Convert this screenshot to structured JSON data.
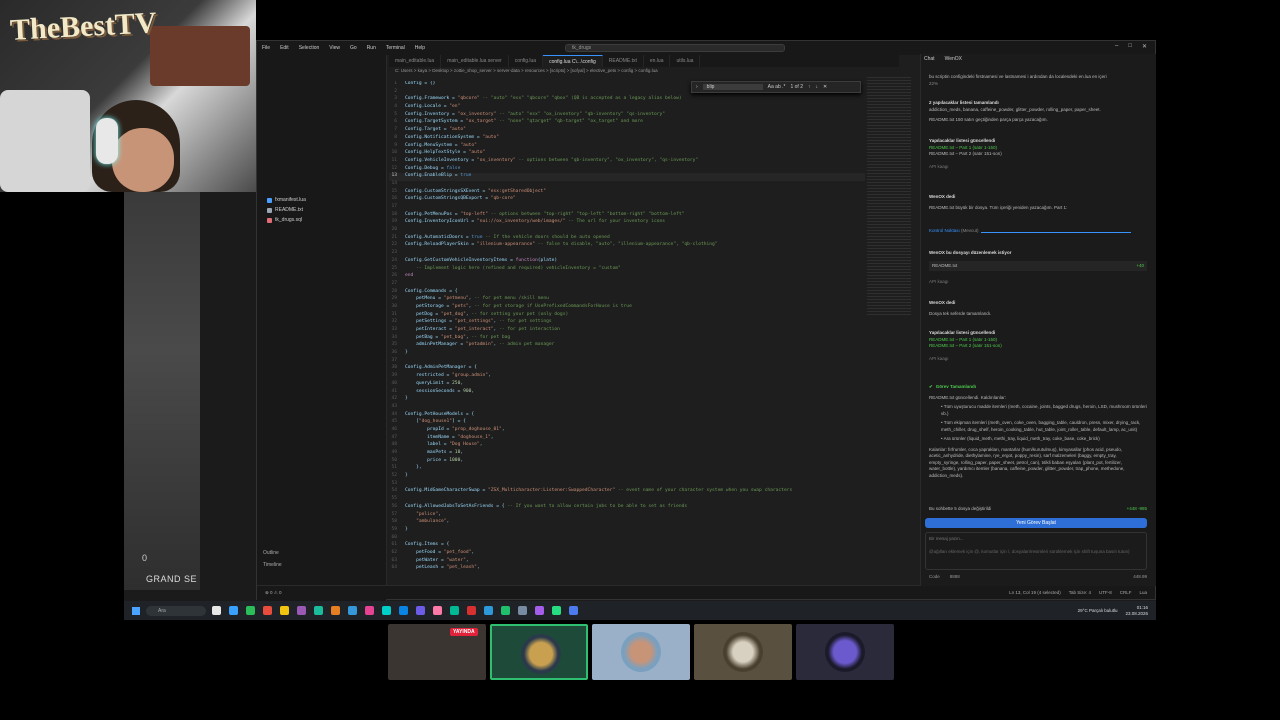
{
  "webcam": {
    "logo": "TheBestTV"
  },
  "game": {
    "text": "GRAND SE",
    "counter": "0"
  },
  "vscode": {
    "menus": [
      "File",
      "Edit",
      "Selection",
      "View",
      "Go",
      "Run",
      "Terminal",
      "Help"
    ],
    "search_placeholder": "tk_drugs",
    "tabs": [
      "main_editable.lua",
      "main_editable.lua server",
      "config.lua",
      "config.lua C\\...\\config",
      "README.txt",
      "en.lua",
      "utils.lua"
    ],
    "active_tab_index": 3,
    "breadcrumb": "C: Users > kaya > Desktop > zottie_shop_server > server-data > resources > [scripts] > [sofyal] > elective_pets > config > config.lua",
    "explorer": {
      "files": [
        {
          "name": "fxmanifest.lua",
          "color": "#4a9eff"
        },
        {
          "name": "README.txt",
          "color": "#9aa5b1"
        },
        {
          "name": "tk_drugs.sql",
          "color": "#e06c75"
        }
      ],
      "sections": [
        "Outline",
        "Timeline"
      ]
    },
    "find": {
      "query": "blip",
      "options": "Aa ab .*",
      "result": "1 of 2"
    },
    "code_lines": [
      "Config = {}",
      "",
      "Config.Framework = \"qbcore\" -- \"auto\" \"esx\" \"qbcore\" \"qbox\" (QB is accepted as a legacy alias below)",
      "Config.Locale = \"en\"",
      "Config.Inventory = \"ox_inventory\" -- \"auto\" \"esx\" \"ox_inventory\" \"qb-inventory\" \"qs-inventory\"",
      "Config.TargetSystem = \"ox_target\" -- \"none\" \"qtarget\" \"qb-target\" \"ox_target\" and more",
      "Config.Target = \"auto\"",
      "Config.NotificationSystem = \"auto\"",
      "Config.MenuSystem = \"auto\"",
      "Config.HelpTextStyle = \"auto\"",
      "Config.VehicleInventory = \"ox_inventory\" -- options between \"qb-inventory\", \"ox_inventory\", \"qs-inventory\"",
      "Config.Debug = false",
      "Config.EnableBlip = true",
      "",
      "Config.CustomStringsSXEvent = \"esx:getSharedObject\"",
      "Config.CustomStringsQBExport = \"qb-core\"",
      "",
      "Config.PetMenuPos = \"top-left\" -- options between \"top-right\" \"top-left\" \"bottom-right\" \"bottom-left\"",
      "Config.InventoryIconUrl = \"nui://ox_inventory/web/images/\" -- The url for your inventory icons",
      "",
      "Config.AutomaticDoors = true -- If the vehicle doors should be auto opened",
      "Config.ReloadPlayerSkin = \"illenium-appearance\" -- false to disable, \"auto\", \"illenium-appearance\", \"qb-clothing\"",
      "",
      "Config.GetCustomVehicleInventoryItems = function(plate)",
      "    -- Implement logic here (refined and required) vehicleInventory = \"custom\"",
      "end",
      "",
      "Config.Commands = {",
      "    petMenu = \"petmenu\", -- for pet menu /skill menu",
      "    petStorage = \"pets\", -- for pet storage if UsePrefixedCommandsForHouse is true",
      "    petDog = \"pet_dog\", -- for setting your pet (only dogs)",
      "    petSettings = \"pet_settings\", -- for pet settings",
      "    petInteract = \"pet_interact\", -- for pet interaction",
      "    petBag = \"pet_bag\", -- for pet bag",
      "    adminPetManager = \"petadmin\", -- admin pet manager",
      "}",
      "",
      "Config.AdminPetManager = {",
      "    restricted = \"group.admin\",",
      "    queryLimit = 250,",
      "    sessionSeconds = 900,",
      "}",
      "",
      "Config.PetHouseModels = {",
      "    [\"dog_house1\"] = {",
      "        propId = \"prop_doghouse_01\",",
      "        itemName = \"doghouse_1\",",
      "        label = \"Dog House\",",
      "        maxPets = 10,",
      "        price = 1000,",
      "    },",
      "}",
      "",
      "Config.MidGameCharacterSwap = \"ZSX_Multicharacter:Listener:SwappedCharacter\" -- event name of your character system when you swap characters",
      "",
      "Config.AllowedJobsToSetAsFriends = { -- If you want to allow certain jobs to be able to set as friends",
      "    \"police\",",
      "    \"ambulance\",",
      "}",
      "",
      "Config.Items = {",
      "    petFood = \"pet_food\",",
      "    petWater = \"water\",",
      "    petLeash = \"pet_leash\","
    ],
    "current_line": 13,
    "status": {
      "left": "⊗ 0 ⚠ 0",
      "position": "Ln 13, Col 19 (4 selected)",
      "spaces": "Tab Size: 4",
      "encoding": "UTF-8",
      "eol": "CRLF",
      "lang": "Lua"
    }
  },
  "chat": {
    "tabs": [
      "Chat",
      "WenOX"
    ],
    "intro": "bu scriptin configindeki firstnamesi ve lastnamesi i ardından da localesdeki en.lua en içeri",
    "pct": "22%",
    "item1_title": "2 yapılacaklar listesi tamamlandı",
    "item1_body": "addiction_meds, banana, caffeine_powder, glitter_powder, rolling_paper, paper_sheet.",
    "item1_note": "README.txt 150 satırı geçtiğinden parça parça yazacağım.",
    "upd1_title": "Yapılacaklar listesi güncellendi",
    "upd1_a": "README.txt – Part 1 (satır 1-150)",
    "upd1_b": "README.txt – Part 2 (satır 151-son)",
    "ask1": "API kaagı",
    "said1": "WenOX dedi",
    "said1_body": "README.txt büyük bir dosya. Tüm içeriği yeniden yazacağım. Part 1:",
    "checkpoint": "Kontrol Noktası",
    "checkpoint_sub": "(Mevcut)",
    "edit_title": "WenOX bu dosyayı düzenlemek istiyor",
    "edit_file": "README.txt",
    "edit_diff": "+40",
    "ask2": "API kaagı",
    "said2": "WenOX dedi",
    "said2_body": "Dosya tek seferde tamamlandı.",
    "upd2_title": "Yapılacaklar listesi güncellendi",
    "upd2_a": "README.txt – Part 1 (satır 1-150)",
    "upd2_b": "README.txt – Part 2 (satır 151-son)",
    "ask3": "API kaagı",
    "done_title": "Görev Tamamlandı",
    "done_sub": "README.txt güncellendi. Kaldırılanlar:",
    "bullets": [
      "Tüm uyuşturucu madde itemleri (meth, cocaine, joints, bagged drugs, heroin, LSD, mushroom ürünleri vb.)",
      "Tüm ekipman itemleri (meth_oven, coke_oven, bagging_table, cauldron, press, mixer, drying_rack, meth_chiller, drug_shelf, heroin_cooking_table, hut_table, joint_roller_table, default_lamp, ac_unit)",
      "Ara ürünler (liquid_meth, methi_tray, liquid_meth_tray, coke_base, coke_brick)"
    ],
    "kept": "Kalanlar: fırfrumler, coca yaprakları, mantarlar (hum/kurutulmuş), kimyasallar (phos acid, pseudo, acetic_anhydride, diethylamine, rye_ergot, poppy_resin), sarf malzemeleri (baggy, empty_tray, empty_syringe, rolling_paper, paper_sheet, petrol_can), tıtikli baban eşyaları (plant_pot, fertilizer, water_bottle), yardımcı itemler (banana, caffeine_powder, glitter_powder, trap_phone, methedone, addiction_meds).",
    "changed": "Bu sohbette 5 dosya değiştirildi",
    "changed_diff": "+448 -985",
    "new_task": "Yeni Görev Başlat",
    "input_placeholder": "Bir mesaj yazın...",
    "input_hint": "@ağılları eklemek için @, komutlar için /, dosyaları/resimleri sürüklemek için shift tuşuna basılı tutun)",
    "footer_mode": "Code",
    "footer_model": "8888",
    "footer_cost": "448.99"
  },
  "taskbar": {
    "search": "Ara",
    "weather": "29°C Parçalı bulutlu",
    "time": "01:16",
    "date": "23.08.2026",
    "icon_colors": [
      "#e8e8e8",
      "#3aa0ff",
      "#2bbd5a",
      "#e74c3c",
      "#f1c40f",
      "#9b59b6",
      "#1abc9c",
      "#e67e22",
      "#3498db",
      "#e84393",
      "#00cec9",
      "#0984e3",
      "#6c5ce7",
      "#fd79a8",
      "#00b894",
      "#d63031",
      "#2d98da",
      "#20bf6b",
      "#778ca3",
      "#a55eea",
      "#26de81",
      "#4b7bec"
    ]
  },
  "thumbnails": {
    "live_label": "YAYINDA",
    "count": 5
  },
  "colors": {
    "accent": "#3794ff",
    "new_task": "#2d6fd6",
    "live": "#e2213a",
    "ok": "#4ec94e"
  }
}
